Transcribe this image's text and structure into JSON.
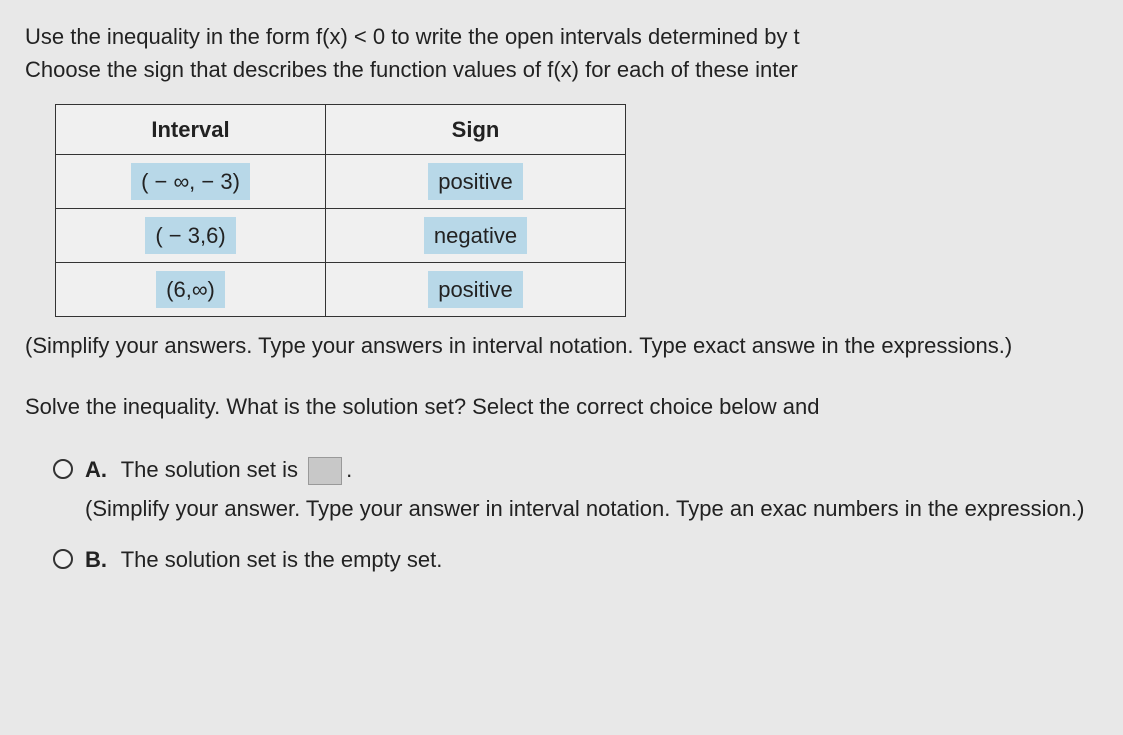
{
  "prompt": {
    "line1": "Use the inequality in the form f(x) < 0 to write the open intervals determined by t",
    "line2": "Choose the sign that describes the function values of f(x) for each of these inter"
  },
  "table": {
    "headers": {
      "col1": "Interval",
      "col2": "Sign"
    },
    "rows": [
      {
        "interval": "( − ∞, − 3)",
        "sign": "positive"
      },
      {
        "interval": "( − 3,6)",
        "sign": "negative"
      },
      {
        "interval": "(6,∞)",
        "sign": "positive"
      }
    ]
  },
  "instruction": "(Simplify your answers. Type your answers in interval notation. Type exact answe in the expressions.)",
  "question": "Solve the inequality. What is the solution set? Select the correct choice below and",
  "choices": {
    "a": {
      "label": "A.",
      "text_before": "The solution set is",
      "text_after": ".",
      "sub": "(Simplify your answer. Type your answer in interval notation. Type an exac numbers in the expression.)"
    },
    "b": {
      "label": "B.",
      "text": "The solution set is the empty set."
    }
  }
}
